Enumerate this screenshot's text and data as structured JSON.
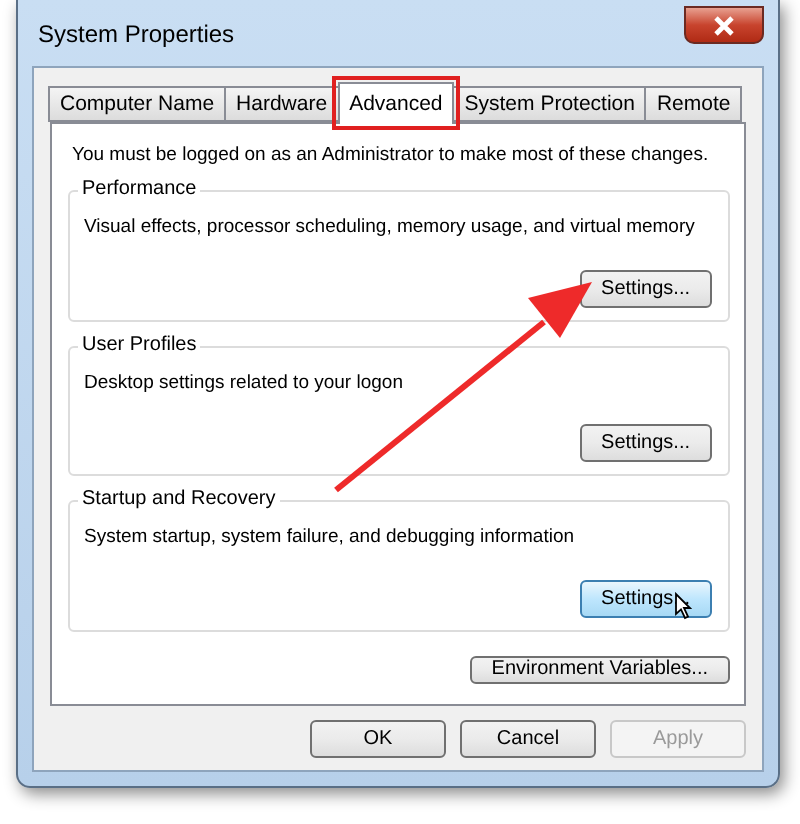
{
  "window": {
    "title": "System Properties"
  },
  "tabs": [
    {
      "label": "Computer Name",
      "selected": false,
      "highlighted": false
    },
    {
      "label": "Hardware",
      "selected": false,
      "highlighted": false
    },
    {
      "label": "Advanced",
      "selected": true,
      "highlighted": true
    },
    {
      "label": "System Protection",
      "selected": false,
      "highlighted": false
    },
    {
      "label": "Remote",
      "selected": false,
      "highlighted": false
    }
  ],
  "notice": "You must be logged on as an Administrator to make most of these changes.",
  "groups": [
    {
      "title": "Performance",
      "description": "Visual effects, processor scheduling, memory usage, and virtual memory",
      "button": "Settings...",
      "hovered": false
    },
    {
      "title": "User Profiles",
      "description": "Desktop settings related to your logon",
      "button": "Settings...",
      "hovered": false
    },
    {
      "title": "Startup and Recovery",
      "description": "System startup, system failure, and debugging information",
      "button": "Settings...",
      "hovered": true
    }
  ],
  "environment_button": "Environment Variables...",
  "buttons": [
    {
      "label": "OK",
      "disabled": false
    },
    {
      "label": "Cancel",
      "disabled": false
    },
    {
      "label": "Apply",
      "disabled": true
    }
  ]
}
